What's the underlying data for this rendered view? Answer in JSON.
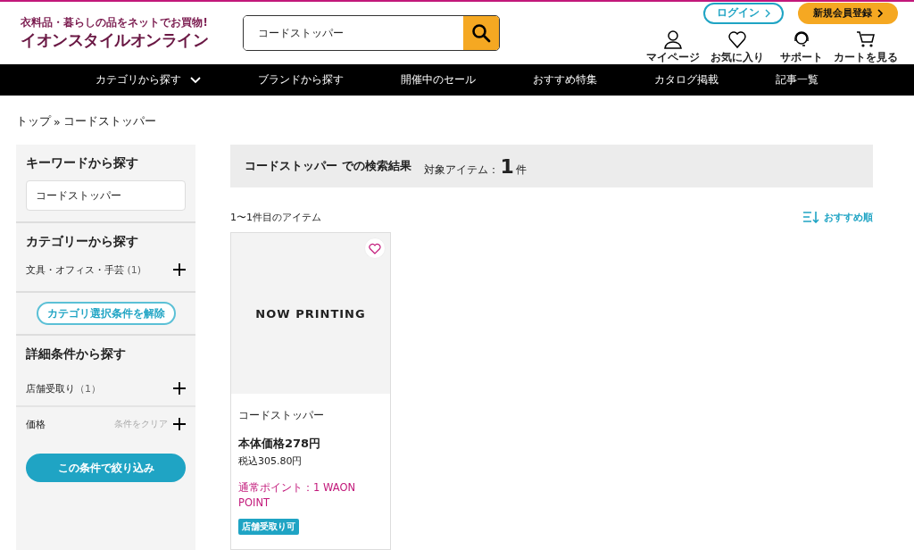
{
  "header": {
    "tagline": "衣料品・暮らしの品をネットでお買物!",
    "logo": "イオンスタイルオンライン",
    "search": {
      "value": "コードストッパー"
    },
    "login": "ログイン",
    "register": "新規会員登録",
    "icons": [
      {
        "kind": "user",
        "label": "マイページ"
      },
      {
        "kind": "heart",
        "label": "お気に入り"
      },
      {
        "kind": "support",
        "label": "サポート"
      },
      {
        "kind": "cart",
        "label": "カートを見る"
      }
    ]
  },
  "nav": [
    {
      "label": "カテゴリから探す",
      "dropdown": true
    },
    {
      "label": "ブランドから探す",
      "dropdown": false
    },
    {
      "label": "開催中のセール",
      "dropdown": false
    },
    {
      "label": "おすすめ特集",
      "dropdown": false
    },
    {
      "label": "カタログ掲載",
      "dropdown": false
    },
    {
      "label": "記事一覧",
      "dropdown": false
    }
  ],
  "breadcrumb": [
    "トップ",
    "コードストッパー"
  ],
  "breadcrumb_separator": "»",
  "sidebar": {
    "keyword_title": "キーワードから探す",
    "keyword": {
      "value": "コードストッパー"
    },
    "category_title": "カテゴリーから探す",
    "categories": [
      {
        "label": "文具・オフィス・手芸",
        "count": "(1)"
      }
    ],
    "clear_category": "カテゴリ選択条件を解除",
    "detail_title": "詳細条件から探す",
    "filters": [
      {
        "label": "店舗受取り",
        "count": "（1）"
      },
      {
        "label": "価格",
        "clear": "条件をクリア"
      }
    ],
    "apply": "この条件で絞り込み"
  },
  "results": {
    "keyword": "コードストッパー",
    "suffix": "での検索結果",
    "target_label": "対象アイテム：",
    "count": "1",
    "unit": "件",
    "range": "1〜1件目のアイテム",
    "sort": "おすすめ順"
  },
  "products": [
    {
      "image_text": "NOW PRINTING",
      "favorite": false,
      "name": "コードストッパー",
      "price": "本体価格278円",
      "tax_price": "税込305.80円",
      "points": "通常ポイント：1 WAON POINT",
      "badge": "店舗受取り可"
    }
  ]
}
